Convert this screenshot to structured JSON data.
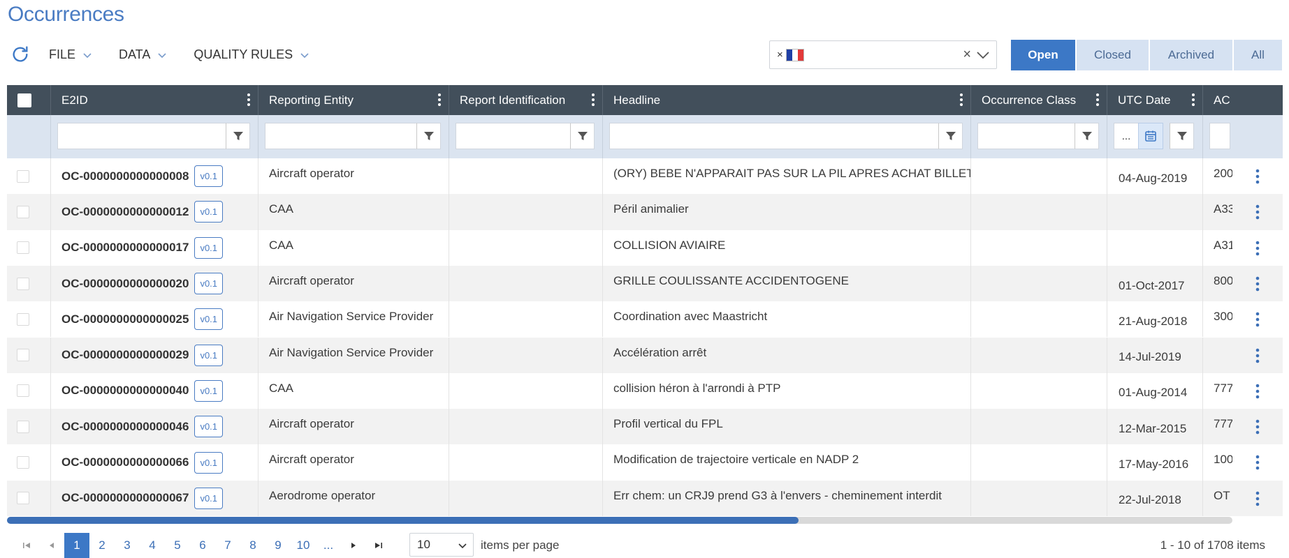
{
  "page_title": "Occurrences",
  "toolbar": {
    "menus": [
      {
        "label": "FILE"
      },
      {
        "label": "DATA"
      },
      {
        "label": "QUALITY RULES"
      }
    ]
  },
  "country_filter": {
    "chip_remove": "×",
    "selected_flag": "France",
    "flag_colors": [
      "#1f3fa6",
      "#ffffff",
      "#e23a3a"
    ],
    "clear_symbol": "×"
  },
  "status_tabs": [
    {
      "label": "Open",
      "active": true
    },
    {
      "label": "Closed",
      "active": false
    },
    {
      "label": "Archived",
      "active": false
    },
    {
      "label": "All",
      "active": false
    }
  ],
  "columns": [
    {
      "key": "e2id",
      "label": "E2ID"
    },
    {
      "key": "reporting_entity",
      "label": "Reporting Entity"
    },
    {
      "key": "report_identification",
      "label": "Report Identification"
    },
    {
      "key": "headline",
      "label": "Headline"
    },
    {
      "key": "occurrence_class",
      "label": "Occurrence Class"
    },
    {
      "key": "utc_date",
      "label": "UTC Date"
    },
    {
      "key": "ac",
      "label": "AC"
    }
  ],
  "date_filter_placeholder": "...",
  "rows": [
    {
      "e2id": "OC-0000000000000008",
      "version": "v0.1",
      "reporting_entity": "Aircraft operator",
      "report_identification": "",
      "headline": "(ORY) BEBE N'APPARAIT PAS SUR LA PIL APRES ACHAT BILLET",
      "occurrence_class": "",
      "utc_date": "04-Aug-2019",
      "ac": "200"
    },
    {
      "e2id": "OC-0000000000000012",
      "version": "v0.1",
      "reporting_entity": "CAA",
      "report_identification": "",
      "headline": "Péril animalier",
      "occurrence_class": "",
      "utc_date": "",
      "ac": "A33"
    },
    {
      "e2id": "OC-0000000000000017",
      "version": "v0.1",
      "reporting_entity": "CAA",
      "report_identification": "",
      "headline": "COLLISION AVIAIRE",
      "occurrence_class": "",
      "utc_date": "",
      "ac": "A31"
    },
    {
      "e2id": "OC-0000000000000020",
      "version": "v0.1",
      "reporting_entity": "Aircraft operator",
      "report_identification": "",
      "headline": "GRILLE COULISSANTE ACCIDENTOGENE",
      "occurrence_class": "",
      "utc_date": "01-Oct-2017",
      "ac": "800"
    },
    {
      "e2id": "OC-0000000000000025",
      "version": "v0.1",
      "reporting_entity": "Air Navigation Service Provider",
      "report_identification": "",
      "headline": "Coordination avec Maastricht",
      "occurrence_class": "",
      "utc_date": "21-Aug-2018",
      "ac": "300"
    },
    {
      "e2id": "OC-0000000000000029",
      "version": "v0.1",
      "reporting_entity": "Air Navigation Service Provider",
      "report_identification": "",
      "headline": "Accélération arrêt",
      "occurrence_class": "",
      "utc_date": "14-Jul-2019",
      "ac": ""
    },
    {
      "e2id": "OC-0000000000000040",
      "version": "v0.1",
      "reporting_entity": "CAA",
      "report_identification": "",
      "headline": "collision héron à l'arrondi à PTP",
      "occurrence_class": "",
      "utc_date": "01-Aug-2014",
      "ac": "777"
    },
    {
      "e2id": "OC-0000000000000046",
      "version": "v0.1",
      "reporting_entity": "Aircraft operator",
      "report_identification": "",
      "headline": "Profil vertical du FPL",
      "occurrence_class": "",
      "utc_date": "12-Mar-2015",
      "ac": "777"
    },
    {
      "e2id": "OC-0000000000000066",
      "version": "v0.1",
      "reporting_entity": "Aircraft operator",
      "report_identification": "",
      "headline": "Modification de trajectoire verticale en NADP 2",
      "occurrence_class": "",
      "utc_date": "17-May-2016",
      "ac": "100"
    },
    {
      "e2id": "OC-0000000000000067",
      "version": "v0.1",
      "reporting_entity": "Aerodrome operator",
      "report_identification": "",
      "headline": "Err chem: un CRJ9 prend G3 à l'envers - cheminement interdit",
      "occurrence_class": "",
      "utc_date": "22-Jul-2018",
      "ac": "OT"
    }
  ],
  "pagination": {
    "pages": [
      "1",
      "2",
      "3",
      "4",
      "5",
      "6",
      "7",
      "8",
      "9",
      "10",
      "..."
    ],
    "current": "1",
    "per_page_value": "10",
    "per_page_label": "items per page",
    "summary": "1 - 10 of 1708 items"
  },
  "colors": {
    "accent": "#3c78c6",
    "header_bg": "#424f5b",
    "filter_bg": "#dbe4f0"
  }
}
